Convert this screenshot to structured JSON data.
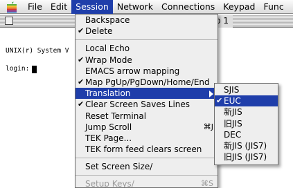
{
  "menubar": {
    "apple_icon": "apple-icon",
    "items": [
      {
        "label": "File"
      },
      {
        "label": "Edit"
      },
      {
        "label": "Session"
      },
      {
        "label": "Network"
      },
      {
        "label": "Connections"
      },
      {
        "label": "Keypad"
      },
      {
        "label": "Func"
      }
    ]
  },
  "window": {
    "title": "p 1",
    "terminal_line1": "UNIX(r) System V",
    "terminal_prompt": "login:"
  },
  "session_menu": {
    "items": [
      {
        "label": "Backspace",
        "checked": false
      },
      {
        "label": "Delete",
        "checked": true
      },
      {
        "label": "Local Echo",
        "checked": false
      },
      {
        "label": "Wrap Mode",
        "checked": true
      },
      {
        "label": "EMACS arrow mapping",
        "checked": false
      },
      {
        "label": "Map PgUp/PgDown/Home/End",
        "checked": true
      },
      {
        "label": "Translation",
        "checked": false,
        "submenu": true
      },
      {
        "label": "Clear Screen Saves Lines",
        "checked": true
      },
      {
        "label": "Reset Terminal",
        "checked": false
      },
      {
        "label": "Jump Scroll",
        "checked": false,
        "shortcut": "⌘J"
      },
      {
        "label": "TEK Page...",
        "checked": false
      },
      {
        "label": "TEK form feed clears screen",
        "checked": false
      },
      {
        "label": "Set Screen Size/",
        "checked": false
      },
      {
        "label": "Setup Keys/",
        "checked": false,
        "shortcut": "⌘S",
        "disabled": true
      }
    ]
  },
  "translation_submenu": {
    "items": [
      {
        "label": "SJIS",
        "checked": false
      },
      {
        "label": "EUC",
        "checked": true
      },
      {
        "label": "新JIS",
        "checked": false
      },
      {
        "label": "旧JIS",
        "checked": false
      },
      {
        "label": "DEC",
        "checked": false
      },
      {
        "label": "新JIS (JIS7)",
        "checked": false
      },
      {
        "label": "旧JIS (JIS7)",
        "checked": false
      }
    ]
  },
  "colors": {
    "highlight": "#1f3eaa",
    "menu_bg": "#eeeeee"
  }
}
